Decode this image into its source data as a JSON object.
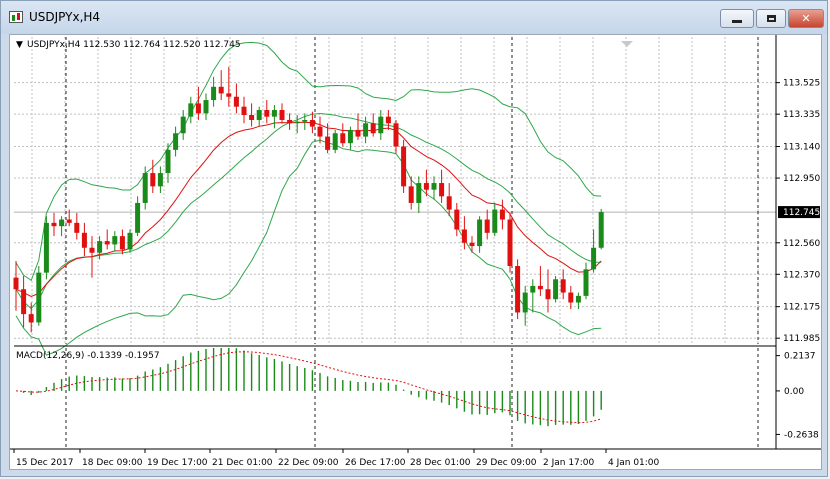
{
  "window": {
    "title": "USDJPYx,H4",
    "buttons": [
      "minimize",
      "restore",
      "close"
    ]
  },
  "chart_data": [
    {
      "type": "candlestick",
      "title": "USDJPYx,H4  112.530 112.764 112.520 112.745",
      "symbol": "USDJPYx",
      "timeframe": "H4",
      "ohlc_header": {
        "open": "112.530",
        "high": "112.764",
        "low": "112.520",
        "close": "112.745"
      },
      "price_ticks": [
        "113.525",
        "113.335",
        "113.140",
        "112.950",
        "112.560",
        "112.370",
        "112.175",
        "111.985"
      ],
      "current_price": "112.745",
      "ylim": [
        111.95,
        113.8
      ],
      "time_ticks": [
        "15 Dec 2017",
        "18 Dec 09:00",
        "19 Dec 17:00",
        "21 Dec 01:00",
        "22 Dec 09:00",
        "26 Dec 17:00",
        "28 Dec 01:00",
        "29 Dec 09:00",
        "2 Jan 17:00",
        "4 Jan 01:00"
      ],
      "grid": true,
      "colors": {
        "bull": "#1a8a1a",
        "bear": "#e01010",
        "bands": "#2ea84a",
        "ma": "#e01010",
        "grid": "#c0c0c0",
        "separator": "#202020"
      },
      "candles": [
        [
          112.35,
          112.45,
          112.15,
          112.28
        ],
        [
          112.28,
          112.36,
          112.05,
          112.13
        ],
        [
          112.13,
          112.2,
          112.02,
          112.08
        ],
        [
          112.08,
          112.42,
          112.06,
          112.38
        ],
        [
          112.38,
          112.72,
          112.34,
          112.68
        ],
        [
          112.68,
          112.74,
          112.6,
          112.66
        ],
        [
          112.66,
          112.72,
          112.6,
          112.7
        ],
        [
          112.7,
          112.76,
          112.66,
          112.68
        ],
        [
          112.68,
          112.74,
          112.58,
          112.62
        ],
        [
          112.62,
          112.68,
          112.48,
          112.53
        ],
        [
          112.53,
          112.6,
          112.35,
          112.5
        ],
        [
          112.5,
          112.6,
          112.46,
          112.57
        ],
        [
          112.57,
          112.64,
          112.52,
          112.55
        ],
        [
          112.55,
          112.63,
          112.51,
          112.6
        ],
        [
          112.6,
          112.64,
          112.49,
          112.52
        ],
        [
          112.52,
          112.64,
          112.5,
          112.62
        ],
        [
          112.62,
          112.84,
          112.6,
          112.8
        ],
        [
          112.8,
          113.02,
          112.76,
          112.98
        ],
        [
          112.98,
          113.06,
          112.86,
          112.9
        ],
        [
          112.9,
          113.02,
          112.86,
          112.98
        ],
        [
          112.98,
          113.16,
          112.92,
          113.12
        ],
        [
          113.12,
          113.26,
          113.08,
          113.22
        ],
        [
          113.22,
          113.36,
          113.18,
          113.32
        ],
        [
          113.32,
          113.44,
          113.28,
          113.4
        ],
        [
          113.4,
          113.5,
          113.3,
          113.34
        ],
        [
          113.34,
          113.46,
          113.3,
          113.42
        ],
        [
          113.42,
          113.56,
          113.38,
          113.5
        ],
        [
          113.5,
          113.6,
          113.42,
          113.46
        ],
        [
          113.46,
          113.62,
          113.38,
          113.44
        ],
        [
          113.44,
          113.52,
          113.34,
          113.38
        ],
        [
          113.38,
          113.44,
          113.28,
          113.33
        ],
        [
          113.33,
          113.4,
          113.26,
          113.3
        ],
        [
          113.3,
          113.38,
          113.26,
          113.36
        ],
        [
          113.36,
          113.42,
          113.28,
          113.32
        ],
        [
          113.32,
          113.39,
          113.25,
          113.36
        ],
        [
          113.36,
          113.4,
          113.28,
          113.3
        ],
        [
          113.3,
          113.34,
          113.24,
          113.28
        ],
        [
          113.28,
          113.33,
          113.22,
          113.29
        ],
        [
          113.29,
          113.34,
          113.24,
          113.3
        ],
        [
          113.3,
          113.35,
          113.22,
          113.26
        ],
        [
          113.26,
          113.32,
          113.16,
          113.2
        ],
        [
          113.2,
          113.28,
          113.1,
          113.12
        ],
        [
          113.12,
          113.24,
          113.1,
          113.22
        ],
        [
          113.22,
          113.28,
          113.14,
          113.16
        ],
        [
          113.16,
          113.26,
          113.12,
          113.24
        ],
        [
          113.24,
          113.34,
          113.18,
          113.2
        ],
        [
          113.2,
          113.32,
          113.16,
          113.28
        ],
        [
          113.28,
          113.34,
          113.2,
          113.22
        ],
        [
          113.22,
          113.36,
          113.18,
          113.32
        ],
        [
          113.32,
          113.36,
          113.24,
          113.28
        ],
        [
          113.28,
          113.3,
          113.1,
          113.14
        ],
        [
          113.14,
          113.18,
          112.86,
          112.9
        ],
        [
          112.9,
          112.96,
          112.76,
          112.8
        ],
        [
          112.8,
          112.96,
          112.74,
          112.92
        ],
        [
          112.92,
          113.0,
          112.84,
          112.88
        ],
        [
          112.88,
          112.96,
          112.82,
          112.92
        ],
        [
          112.92,
          113.0,
          112.8,
          112.84
        ],
        [
          112.84,
          112.92,
          112.72,
          112.76
        ],
        [
          112.76,
          112.8,
          112.6,
          112.64
        ],
        [
          112.64,
          112.72,
          112.52,
          112.56
        ],
        [
          112.56,
          112.6,
          112.5,
          112.54
        ],
        [
          112.54,
          112.72,
          112.5,
          112.7
        ],
        [
          112.7,
          112.76,
          112.58,
          112.62
        ],
        [
          112.62,
          112.8,
          112.6,
          112.76
        ],
        [
          112.76,
          112.82,
          112.64,
          112.7
        ],
        [
          112.7,
          112.74,
          112.38,
          112.42
        ],
        [
          112.42,
          112.46,
          112.1,
          112.14
        ],
        [
          112.14,
          112.3,
          112.06,
          112.26
        ],
        [
          112.26,
          112.34,
          112.14,
          112.3
        ],
        [
          112.3,
          112.42,
          112.24,
          112.28
        ],
        [
          112.28,
          112.4,
          112.14,
          112.22
        ],
        [
          112.22,
          112.36,
          112.2,
          112.34
        ],
        [
          112.34,
          112.4,
          112.22,
          112.26
        ],
        [
          112.26,
          112.3,
          112.16,
          112.2
        ],
        [
          112.2,
          112.26,
          112.16,
          112.24
        ],
        [
          112.24,
          112.44,
          112.22,
          112.4
        ],
        [
          112.4,
          112.64,
          112.38,
          112.53
        ],
        [
          112.53,
          112.764,
          112.52,
          112.745
        ]
      ]
    },
    {
      "type": "bar",
      "title": "MACD(12,26,9) -0.1339 -0.1957",
      "indicator": "MACD(12,26,9)",
      "values_header": [
        "-0.1339",
        "-0.1957"
      ],
      "y_ticks": [
        "0.2137",
        "0.00",
        "-0.2638"
      ],
      "ylim": [
        -0.34,
        0.26
      ],
      "colors": {
        "histogram": "#1a8a1a",
        "signal": "#e01010"
      }
    }
  ]
}
